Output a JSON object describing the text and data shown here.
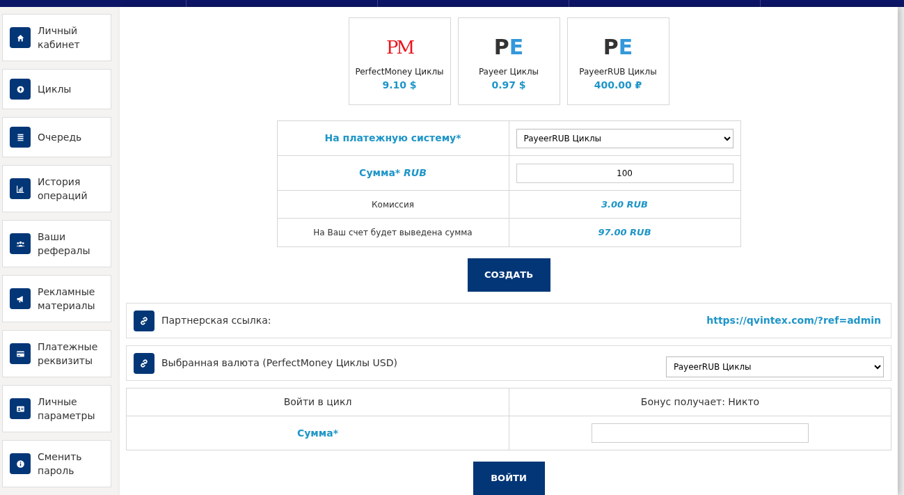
{
  "sidebar": {
    "items": [
      {
        "label": "Личный кабинет"
      },
      {
        "label": "Циклы"
      },
      {
        "label": "Очередь"
      },
      {
        "label": "История операций"
      },
      {
        "label": "Ваши рефералы"
      },
      {
        "label": "Рекламные материалы"
      },
      {
        "label": "Платежные реквизиты"
      },
      {
        "label": "Личные параметры"
      },
      {
        "label": "Сменить пароль"
      }
    ]
  },
  "wallets": [
    {
      "kind": "pm",
      "logo": "PM",
      "name": "PerfectMoney Циклы",
      "balance": "9.10 $"
    },
    {
      "kind": "pe",
      "logo": "PE",
      "name": "Payeer Циклы",
      "balance": "0.97 $"
    },
    {
      "kind": "pe",
      "logo": "PE",
      "name": "PayeerRUB Циклы",
      "balance": "400.00 ₽"
    }
  ],
  "withdraw_form": {
    "rows": [
      {
        "kind": "select",
        "label": "На платежную систему*",
        "value": "PayeerRUB Циклы"
      },
      {
        "kind": "input",
        "label": "Сумма* *RUB*",
        "value": "100"
      },
      {
        "kind": "text",
        "label": "Комиссия",
        "value": "3.00 RUB"
      },
      {
        "kind": "text",
        "label": "На Ваш счет будет выведена сумма",
        "value": "97.00 RUB"
      }
    ],
    "button": "СОЗДАТЬ"
  },
  "partner_link": {
    "label": "Партнерская ссылка:",
    "url": "https://qvintex.com/?ref=admin"
  },
  "currency": {
    "label": "Выбранная валюта (PerfectMoney Циклы USD)",
    "value": "PayeerRUB Циклы"
  },
  "enter_cycle": {
    "title": "Войти в цикл",
    "bonus": "Бонус получает: Никто",
    "amount_label": "Сумма*",
    "button": "ВОЙТИ"
  }
}
